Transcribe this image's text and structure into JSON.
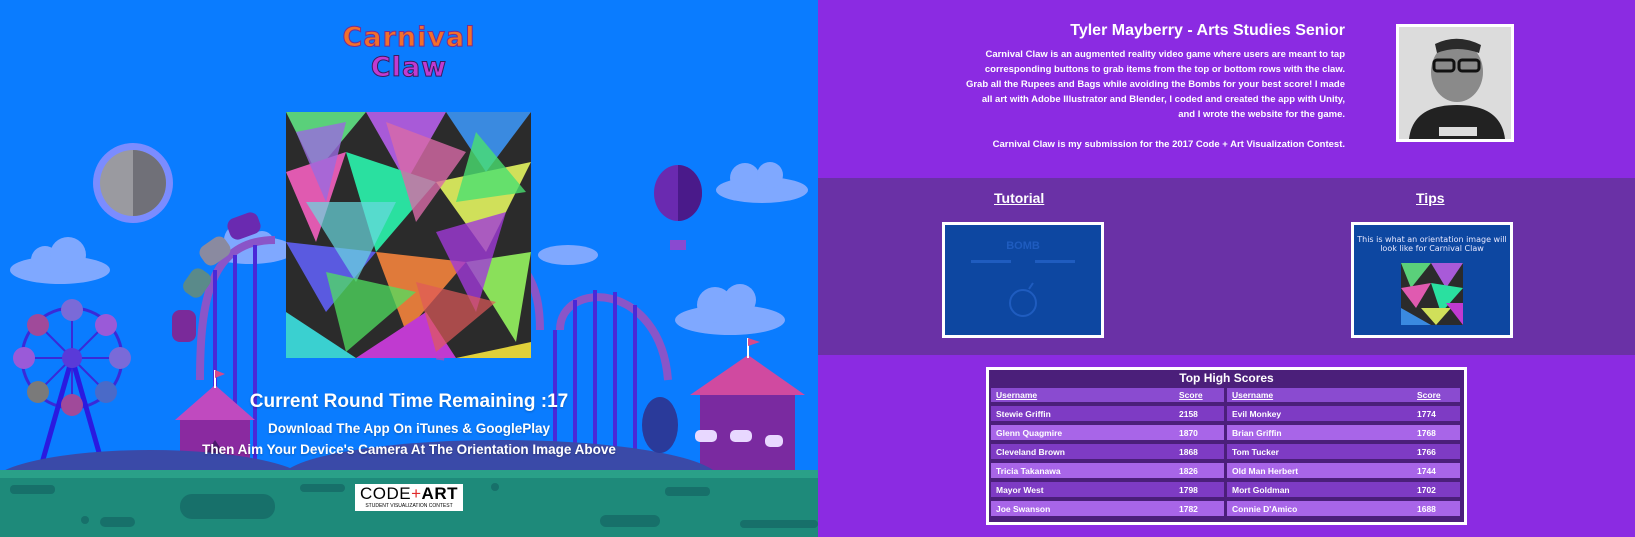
{
  "game": {
    "logo_line1": "Carnival",
    "logo_line2": "Claw",
    "timer": "Current Round Time Remaining :17",
    "download": "Download The App On iTunes & GooglePlay",
    "instruction": "Then Aim Your Device's Camera At The Orientation Image Above",
    "badge_big_a": "CODE",
    "badge_big_b": "ART",
    "badge_small": "STUDENT VISUALIZATION CONTEST"
  },
  "about": {
    "name": "Tyler Mayberry - Arts Studies Senior",
    "bio": "Carnival Claw is an augmented reality video game where users are meant to tap corresponding buttons to grab items from the top or bottom rows with the claw. Grab all the Rupees and Bags while avoiding the Bombs for your best score! I made all art with Adobe Illustrator and Blender, I coded and created the app with Unity, and I wrote the website for the game.",
    "submission": "Carnival Claw is my submission for the 2017 Code + Art Visualization Contest."
  },
  "sections": {
    "tutorial": "Tutorial",
    "tips": "Tips",
    "tutorial_bomb": "BOMB",
    "tips_text": "This is what an orientation image will look like for Carnival Claw"
  },
  "scores": {
    "title": "Top High Scores",
    "col_user": "Username",
    "col_score": "Score",
    "left": [
      {
        "user": "Stewie Griffin",
        "score": "2158"
      },
      {
        "user": "Glenn Quagmire",
        "score": "1870"
      },
      {
        "user": "Cleveland Brown",
        "score": "1868"
      },
      {
        "user": "Tricia Takanawa",
        "score": "1826"
      },
      {
        "user": "Mayor West",
        "score": "1798"
      },
      {
        "user": "Joe Swanson",
        "score": "1782"
      }
    ],
    "right": [
      {
        "user": "Evil Monkey",
        "score": "1774"
      },
      {
        "user": "Brian Griffin",
        "score": "1768"
      },
      {
        "user": "Tom Tucker",
        "score": "1766"
      },
      {
        "user": "Old Man Herbert",
        "score": "1744"
      },
      {
        "user": "Mort Goldman",
        "score": "1702"
      },
      {
        "user": "Connie D'Amico",
        "score": "1688"
      }
    ]
  },
  "colors": {
    "sky": "#0a7cff",
    "purple": "#8b2be2",
    "mid_purple": "#6a31a6",
    "ground": "#1e8a7a"
  }
}
